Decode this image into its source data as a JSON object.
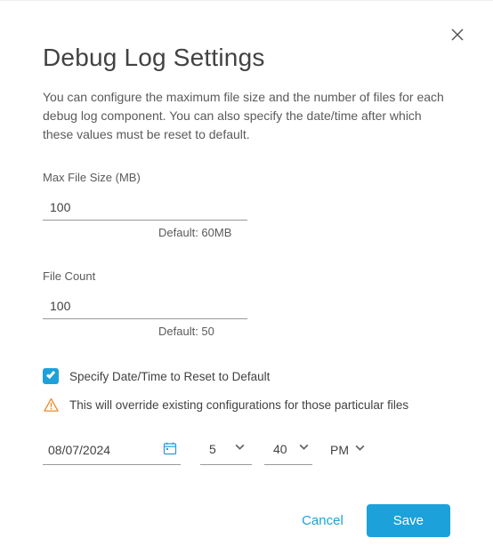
{
  "header": {
    "title": "Debug Log Settings",
    "description": "You can configure the maximum file size and the number of files for each debug log component. You can also specify the date/time after which these values must be reset to default."
  },
  "fields": {
    "maxFileSize": {
      "label": "Max File Size (MB)",
      "value": "100",
      "default_hint": "Default: 60MB"
    },
    "fileCount": {
      "label": "File Count",
      "value": "100",
      "default_hint": "Default: 50"
    }
  },
  "reset": {
    "checkbox_label": "Specify Date/Time to Reset to Default",
    "warning": "This will override existing configurations for those particular files"
  },
  "datetime": {
    "date": "08/07/2024",
    "hour": "5",
    "minute": "40",
    "ampm": "PM"
  },
  "actions": {
    "cancel": "Cancel",
    "save": "Save"
  }
}
